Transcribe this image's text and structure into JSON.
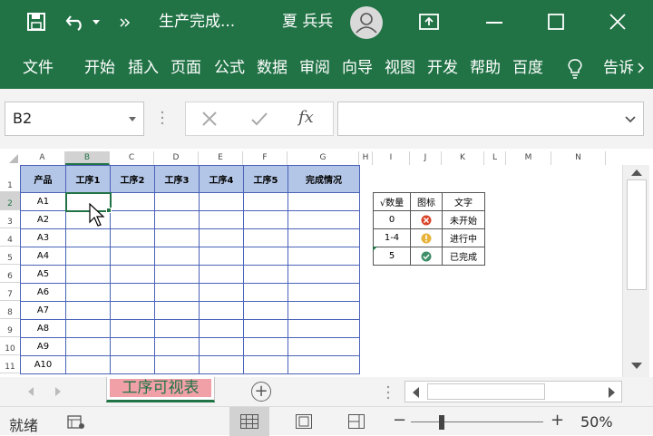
{
  "titlebar": {
    "save_icon": "save-icon",
    "undo_icon": "undo-icon",
    "file_title": "生产完成...",
    "user_name": "夏 兵兵",
    "min_glyph": "—",
    "close_glyph": "✕"
  },
  "ribbon": {
    "tabs": [
      "文件",
      "开始",
      "插入",
      "页面",
      "公式",
      "数据",
      "审阅",
      "向导",
      "视图",
      "开发",
      "帮助",
      "百度",
      "告诉"
    ]
  },
  "formula_bar": {
    "name_box": "B2",
    "fx": "fx",
    "formula": ""
  },
  "grid": {
    "columns": [
      "A",
      "B",
      "C",
      "D",
      "E",
      "F",
      "G",
      "H",
      "I",
      "J",
      "K",
      "L",
      "M",
      "N"
    ],
    "rows": [
      "1",
      "2",
      "3",
      "4",
      "5",
      "6",
      "7",
      "8",
      "9",
      "10",
      "11"
    ],
    "selected_cell": "B2",
    "table_headers": [
      "产品",
      "工序1",
      "工序2",
      "工序3",
      "工序4",
      "工序5",
      "完成情况"
    ],
    "products": [
      "A1",
      "A2",
      "A3",
      "A4",
      "A5",
      "A6",
      "A7",
      "A8",
      "A9",
      "A10"
    ]
  },
  "legend": {
    "headers": [
      "√数量",
      "图标",
      "文字"
    ],
    "rows": [
      {
        "qty": "0",
        "icon": "red-x-icon",
        "text": "未开始",
        "color": "#d9472b"
      },
      {
        "qty": "1-4",
        "icon": "yellow-exclamation-icon",
        "text": "进行中",
        "color": "#e8b33a"
      },
      {
        "qty": "5",
        "icon": "green-check-icon",
        "text": "已完成",
        "color": "#3f8f6a"
      }
    ]
  },
  "sheet": {
    "active_tab": "工序可视表",
    "add_sheet": "+",
    "tab_fill_color": "#f2a0a8",
    "tab_text_color": "#217346"
  },
  "status": {
    "ready": "就绪",
    "zoom": "50%",
    "zoom_minus": "−",
    "zoom_plus": "+"
  },
  "colors": {
    "brand": "#217346",
    "header_fill": "#b4c6e7",
    "border_blue": "#4a62b8"
  }
}
